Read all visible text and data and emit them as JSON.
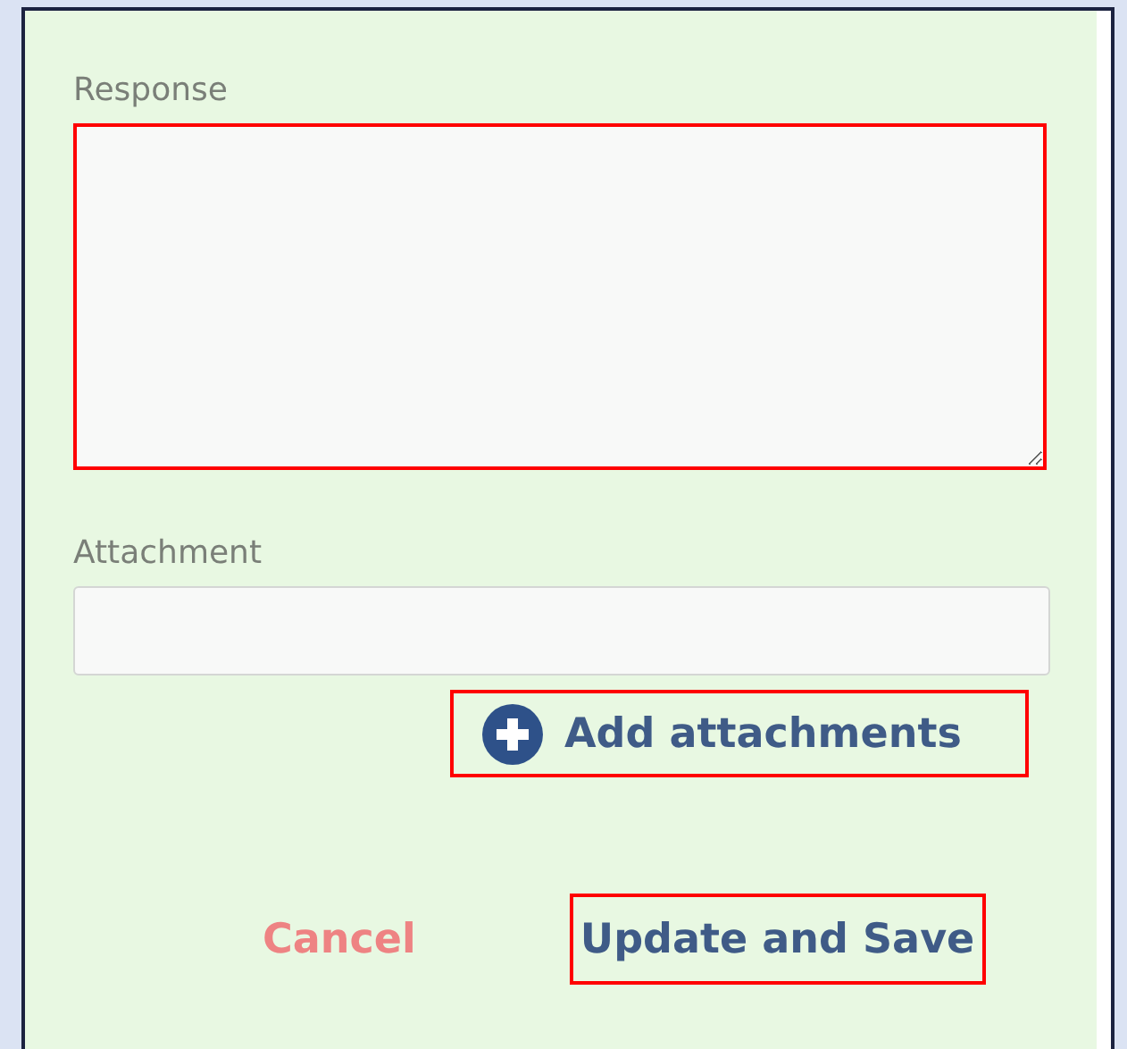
{
  "fields": [
    {
      "kind": "textarea",
      "label": "Response",
      "highlighted": true
    },
    {
      "kind": "input",
      "label": "Attachment",
      "highlighted": false
    }
  ],
  "add_attachments": {
    "label": "Add attachments",
    "highlighted": true
  },
  "buttons": [
    {
      "label": "Cancel",
      "kind": "cancel",
      "highlighted": false
    },
    {
      "label": "Update and Save",
      "kind": "primary",
      "highlighted": true
    }
  ]
}
